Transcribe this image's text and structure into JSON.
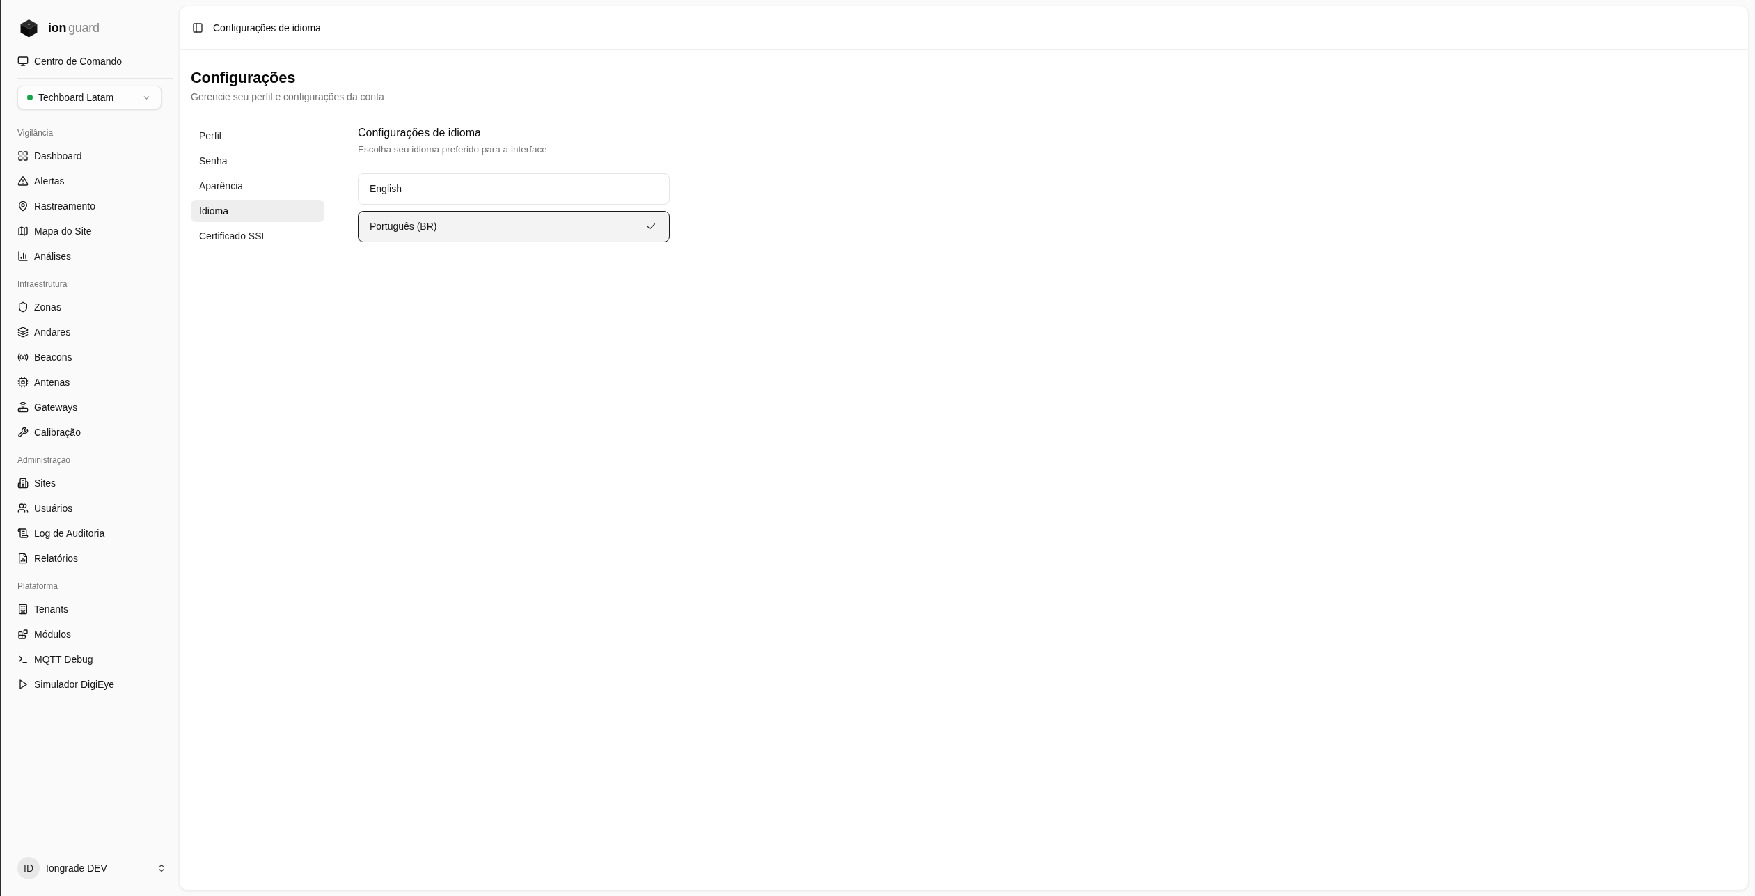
{
  "sidebar": {
    "brand": {
      "name": "ion",
      "suffix": "guard"
    },
    "command_center": {
      "label": "Centro de Comando"
    },
    "tenant_select": {
      "value": "Techboard Latam",
      "online": true
    },
    "sections": [
      {
        "label": "Vigilância",
        "items": [
          {
            "label": "Dashboard"
          },
          {
            "label": "Alertas"
          },
          {
            "label": "Rastreamento"
          },
          {
            "label": "Mapa do Site"
          },
          {
            "label": "Análises"
          }
        ]
      },
      {
        "label": "Infraestrutura",
        "items": [
          {
            "label": "Zonas"
          },
          {
            "label": "Andares"
          },
          {
            "label": "Beacons"
          },
          {
            "label": "Antenas"
          },
          {
            "label": "Gateways"
          },
          {
            "label": "Calibração"
          }
        ]
      },
      {
        "label": "Administração",
        "items": [
          {
            "label": "Sites"
          },
          {
            "label": "Usuários"
          },
          {
            "label": "Log de Auditoria"
          },
          {
            "label": "Relatórios"
          }
        ]
      },
      {
        "label": "Plataforma",
        "items": [
          {
            "label": "Tenants"
          },
          {
            "label": "Módulos"
          },
          {
            "label": "MQTT Debug"
          },
          {
            "label": "Simulador DigiEye"
          }
        ]
      }
    ],
    "user": {
      "initials": "ID",
      "name": "Iongrade DEV"
    }
  },
  "main": {
    "header": {
      "title": "Configurações de idioma"
    },
    "page": {
      "title": "Configurações",
      "subtitle": "Gerencie seu perfil e configurações da conta"
    },
    "settings_nav": [
      {
        "label": "Perfil",
        "selected": false
      },
      {
        "label": "Senha",
        "selected": false
      },
      {
        "label": "Aparência",
        "selected": false
      },
      {
        "label": "Idioma",
        "selected": true
      },
      {
        "label": "Certificado SSL",
        "selected": false
      }
    ],
    "section": {
      "title": "Configurações de idioma",
      "subtitle": "Escolha seu idioma preferido para a interface",
      "options": [
        {
          "label": "English",
          "selected": false
        },
        {
          "label": "Português (BR)",
          "selected": true
        }
      ]
    }
  }
}
